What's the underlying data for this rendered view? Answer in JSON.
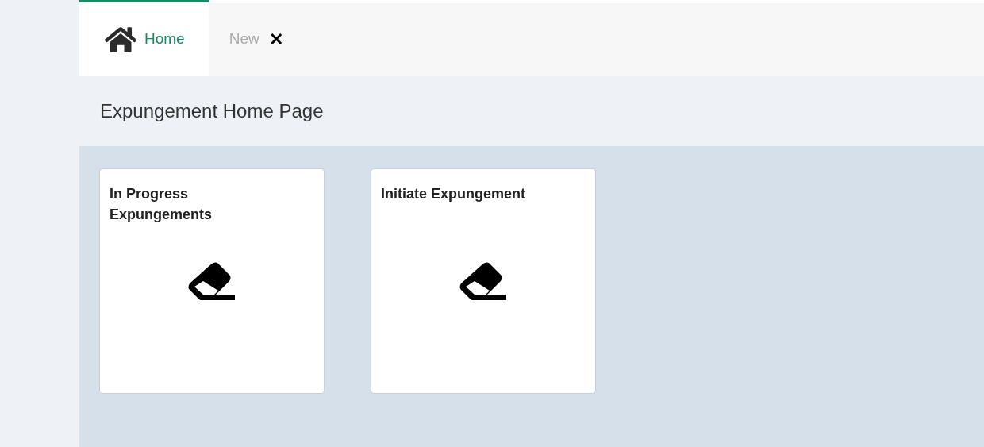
{
  "tabs": [
    {
      "kind": "home",
      "label": "Home",
      "selected": true
    },
    {
      "kind": "closable",
      "label": "New",
      "selected": false,
      "close_glyph": "✕"
    }
  ],
  "page_title": "Expungement Home Page",
  "tiles": [
    {
      "title": "In Progress Expungements"
    },
    {
      "title": "Initiate Expungement"
    }
  ]
}
